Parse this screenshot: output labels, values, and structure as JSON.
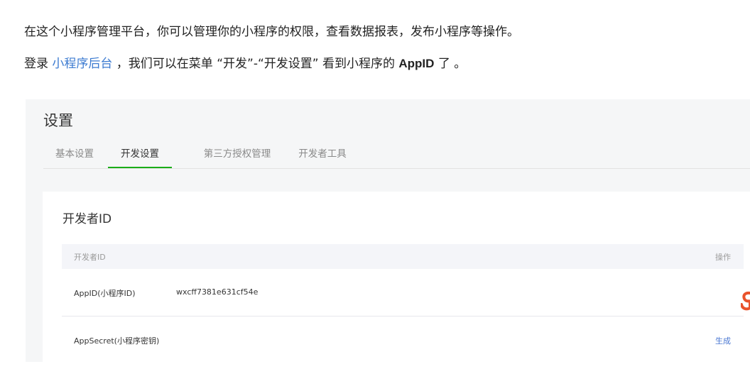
{
  "intro": {
    "line1": "在这个小程序管理平台，你可以管理你的小程序的权限，查看数据报表，发布小程序等操作。",
    "line2_prefix": "登录 ",
    "line2_link": "小程序后台",
    "line2_middle": " ，我们可以在菜单 “开发”-“开发设置” 看到小程序的 ",
    "line2_bold": "AppID",
    "line2_suffix": " 了 。"
  },
  "settings": {
    "title": "设置",
    "tabs": [
      {
        "label": "基本设置"
      },
      {
        "label": "开发设置"
      },
      {
        "label": "第三方授权管理"
      },
      {
        "label": "开发者工具"
      }
    ],
    "active_tab": "开发设置",
    "card": {
      "title": "开发者ID",
      "table_header": {
        "left": "开发者ID",
        "right": "操作"
      },
      "rows": [
        {
          "name": "AppID(小程序ID)",
          "value": "wxcff7381e631cf54e",
          "action": ""
        },
        {
          "name": "AppSecret(小程序密钥)",
          "value": "",
          "action": "生成"
        }
      ]
    }
  },
  "colors": {
    "link": "#3c7bd1",
    "tab_active_underline": "#1aad19",
    "action_link": "#4a77d2",
    "logo_fragment": "#e9532c"
  },
  "icons": [
    "logo-fragment-icon"
  ]
}
